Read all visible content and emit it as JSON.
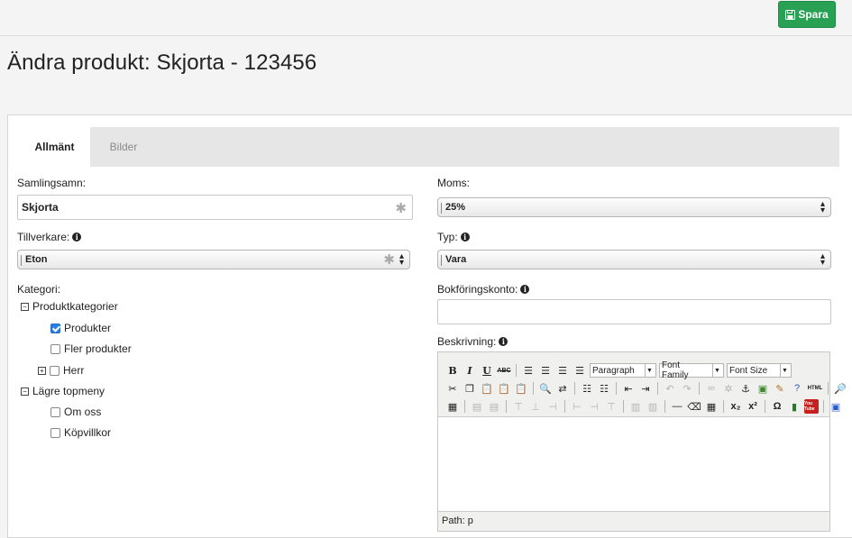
{
  "toolbar": {
    "save_label": "Spara"
  },
  "page": {
    "title": "Ändra produkt: Skjorta - 123456"
  },
  "tabs": [
    {
      "label": "Allmänt"
    },
    {
      "label": "Bilder"
    }
  ],
  "form": {
    "samlingsnamn": {
      "label": "Samlingsamn:",
      "value": "Skjorta"
    },
    "tillverkare": {
      "label": "Tillverkare:",
      "value": "Eton"
    },
    "kategori": {
      "label": "Kategori:"
    },
    "moms": {
      "label": "Moms:",
      "value": "25%"
    },
    "typ": {
      "label": "Typ:",
      "value": "Vara"
    },
    "bokforingskonto": {
      "label": "Bokföringskonto:",
      "value": ""
    },
    "beskrivning": {
      "label": "Beskrivning:"
    }
  },
  "category_tree": [
    {
      "label": "Produktkategorier",
      "toggle": "⊟",
      "checked": null
    },
    {
      "label": "Produkter",
      "checked": true
    },
    {
      "label": "Fler produkter",
      "checked": false
    },
    {
      "label": "Herr",
      "toggle": "⊞",
      "checked": false
    },
    {
      "label": "Lägre topmeny",
      "toggle": "⊟",
      "checked": null
    },
    {
      "label": "Om oss",
      "checked": false
    },
    {
      "label": "Köpvillkor",
      "checked": false
    }
  ],
  "editor": {
    "format_paragraph": "Paragraph",
    "font_family": "Font Family",
    "font_size": "Font Size",
    "path_label": "Path: p",
    "html_button": "HTML",
    "youtube_button": "You Tube"
  }
}
